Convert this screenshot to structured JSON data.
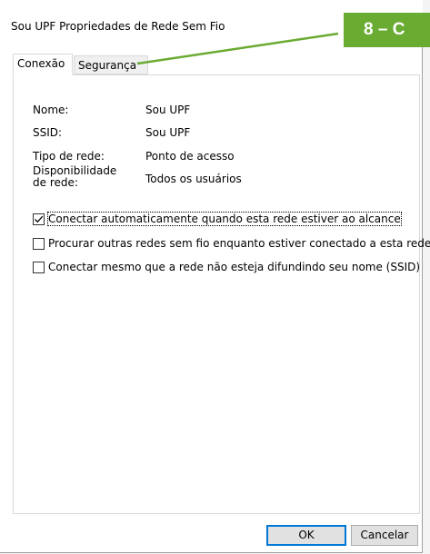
{
  "window": {
    "title": "Sou UPF Propriedades de Rede Sem Fio"
  },
  "annotation": {
    "step_label": "8 – C",
    "color": "#6aab32"
  },
  "tabs": [
    {
      "label": "Conexão",
      "active": true
    },
    {
      "label": "Segurança",
      "active": false
    }
  ],
  "fields": {
    "nome_label": "Nome:",
    "nome_value": "Sou UPF",
    "ssid_label": "SSID:",
    "ssid_value": "Sou UPF",
    "tipo_label": "Tipo de rede:",
    "tipo_value": "Ponto de acesso",
    "disp_label": "Disponibilidade de rede:",
    "disp_value": "Todos os usuários"
  },
  "options": [
    {
      "label": "Conectar automaticamente quando esta rede estiver ao alcance",
      "checked": true
    },
    {
      "label": "Procurar outras redes sem fio enquanto estiver conectado a esta rede",
      "checked": false
    },
    {
      "label": "Conectar mesmo que a rede não esteja difundindo seu nome (SSID)",
      "checked": false
    }
  ],
  "buttons": {
    "ok": "OK",
    "cancel": "Cancelar"
  },
  "colors": {
    "accent": "#0078d7",
    "badge": "#6aab32"
  }
}
